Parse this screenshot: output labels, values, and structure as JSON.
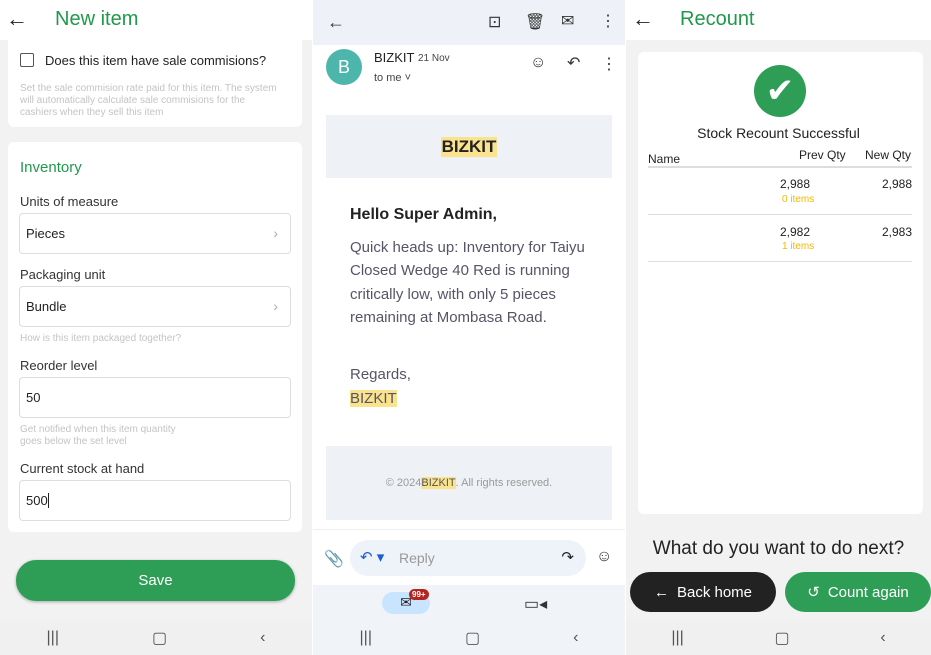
{
  "new_item": {
    "title": "New item",
    "commission_label": "Does this item have sale commisions?",
    "commission_hint": "Set the sale commision rate paid for this item. The system will automatically calculate sale commisions for the cashiers when they sell this item",
    "commission_checked": false,
    "section": "Inventory",
    "uom_label": "Units of measure",
    "uom_value": "Pieces",
    "pack_label": "Packaging unit",
    "pack_value": "Bundle",
    "pack_hint": "How is this item packaged together?",
    "reorder_label": "Reorder level",
    "reorder_value": "50",
    "reorder_hint": "Get notified when this item quantity goes below the set level",
    "stock_label": "Current stock at hand",
    "stock_value": "500",
    "save": "Save"
  },
  "email": {
    "sender": "BIZKIT",
    "date": "21 Nov",
    "avatar": "B",
    "to": "to me",
    "brand": "BIZKIT",
    "greeting": "Hello Super Admin,",
    "body": "Quick heads up: Inventory for Taiyu Closed Wedge 40 Red is running critically low, with only 5 pieces remaining at Mombasa Road.",
    "regards": "Regards,",
    "signature": "BIZKIT",
    "footer_pre": "© 2024 ",
    "footer_brand": "BIZKIT",
    "footer_post": ". All rights reserved.",
    "reply_placeholder": "Reply",
    "badge": "99+"
  },
  "recount": {
    "title": "Recount",
    "success": "Stock Recount Successful",
    "columns": [
      "Name",
      "Prev Qty",
      "New Qty"
    ],
    "rows": [
      {
        "name": "",
        "prev": "2,988",
        "diff": "0  items",
        "new": "2,988"
      },
      {
        "name": "",
        "prev": "2,982",
        "diff": "1  items",
        "new": "2,983"
      }
    ],
    "prompt": "What do you want to do next?",
    "back_home": "Back home",
    "count_again": "Count again"
  },
  "colors": {
    "green": "#2e9e57",
    "title_green": "#1f9a4a",
    "amber": "#f5b800",
    "avatar": "#4db6ac",
    "badge": "#b3261e"
  }
}
